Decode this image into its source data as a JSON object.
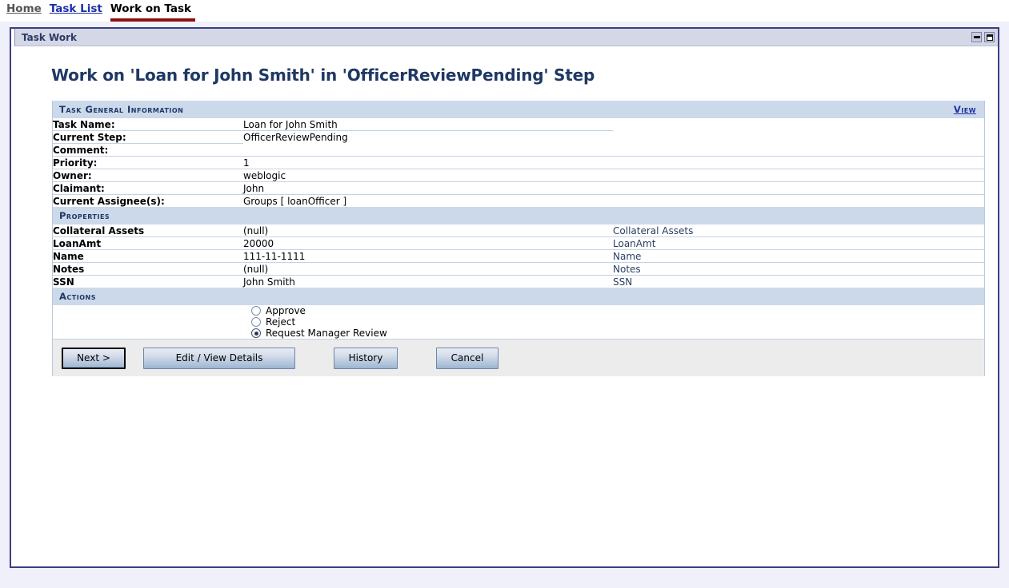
{
  "breadcrumb": {
    "items": [
      {
        "label": "Home",
        "type": "visited"
      },
      {
        "label": "Task List",
        "type": "link"
      },
      {
        "label": "Work on Task",
        "type": "current"
      }
    ]
  },
  "window": {
    "title": "Task Work",
    "minimize_tooltip": "Minimize",
    "maximize_tooltip": "Maximize"
  },
  "page": {
    "heading": "Work on 'Loan for John Smith' in 'OfficerReviewPending' Step"
  },
  "general": {
    "section_title": "Task General Information",
    "view_link": "View",
    "rows": [
      {
        "label": "Task Name:",
        "value": "Loan for John Smith"
      },
      {
        "label": "Current Step:",
        "value": "OfficerReviewPending"
      },
      {
        "label": "Comment:",
        "value": ""
      },
      {
        "label": "Priority:",
        "value": "1"
      },
      {
        "label": "Owner:",
        "value": "weblogic"
      },
      {
        "label": "Claimant:",
        "value": "John"
      },
      {
        "label": "Current Assignee(s):",
        "value": "Groups [ loanOfficer ]"
      }
    ]
  },
  "properties": {
    "section_title": "Properties",
    "rows": [
      {
        "label": "Collateral Assets",
        "value": "(null)",
        "aux": "Collateral Assets"
      },
      {
        "label": "LoanAmt",
        "value": "20000",
        "aux": "LoanAmt"
      },
      {
        "label": "Name",
        "value": "111-11-1111",
        "aux": "Name"
      },
      {
        "label": "Notes",
        "value": "(null)",
        "aux": "Notes"
      },
      {
        "label": "SSN",
        "value": "John Smith",
        "aux": "SSN"
      }
    ]
  },
  "actions": {
    "section_title": "Actions",
    "options": [
      {
        "label": "Approve",
        "selected": false
      },
      {
        "label": "Reject",
        "selected": false
      },
      {
        "label": "Request Manager Review",
        "selected": true
      }
    ]
  },
  "buttons": {
    "next": "Next >",
    "edit_view_details": "Edit / View Details",
    "history": "History",
    "cancel": "Cancel"
  },
  "colors": {
    "accent_navy": "#1f3864",
    "section_bg": "#ccd9ea",
    "link_blue": "#1b2fa0",
    "current_tab_underline": "#8b0f0f",
    "frame_border": "#3b3f80",
    "page_bg": "#f0f0fb"
  }
}
